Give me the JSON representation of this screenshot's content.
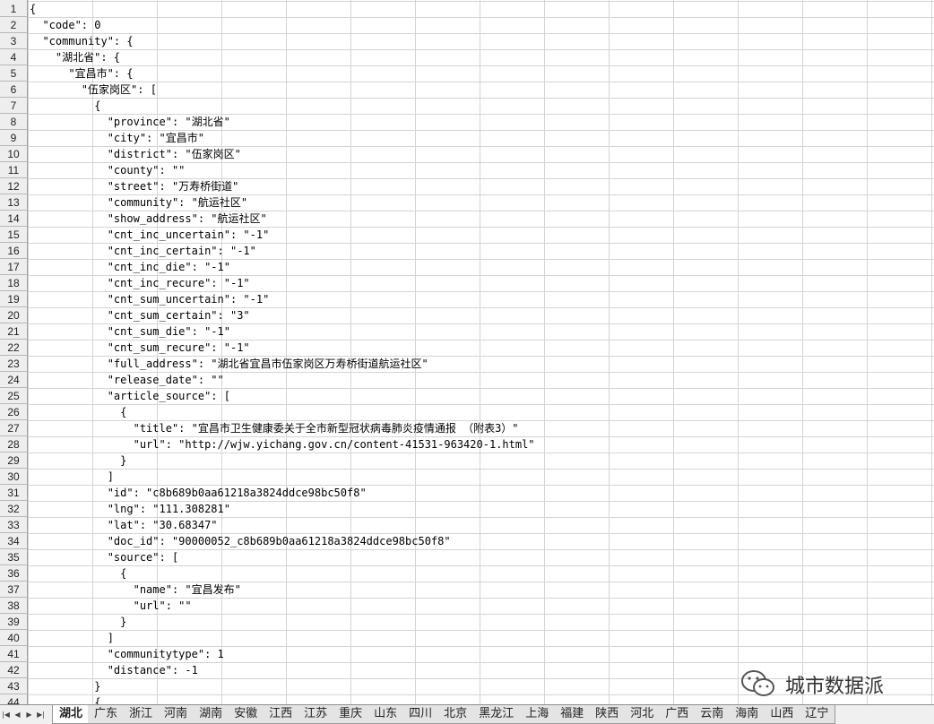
{
  "lines": [
    "{",
    "  \"code\": 0",
    "  \"community\": {",
    "    \"湖北省\": {",
    "      \"宜昌市\": {",
    "        \"伍家岗区\": [",
    "          {",
    "            \"province\": \"湖北省\"",
    "            \"city\": \"宜昌市\"",
    "            \"district\": \"伍家岗区\"",
    "            \"county\": \"\"",
    "            \"street\": \"万寿桥街道\"",
    "            \"community\": \"航运社区\"",
    "            \"show_address\": \"航运社区\"",
    "            \"cnt_inc_uncertain\": \"-1\"",
    "            \"cnt_inc_certain\": \"-1\"",
    "            \"cnt_inc_die\": \"-1\"",
    "            \"cnt_inc_recure\": \"-1\"",
    "            \"cnt_sum_uncertain\": \"-1\"",
    "            \"cnt_sum_certain\": \"3\"",
    "            \"cnt_sum_die\": \"-1\"",
    "            \"cnt_sum_recure\": \"-1\"",
    "            \"full_address\": \"湖北省宜昌市伍家岗区万寿桥街道航运社区\"",
    "            \"release_date\": \"\"",
    "            \"article_source\": [",
    "              {",
    "                \"title\": \"宜昌市卫生健康委关于全市新型冠状病毒肺炎疫情通报 （附表3）\"",
    "                \"url\": \"http://wjw.yichang.gov.cn/content-41531-963420-1.html\"",
    "              }",
    "            ]",
    "            \"id\": \"c8b689b0aa61218a3824ddce98bc50f8\"",
    "            \"lng\": \"111.308281\"",
    "            \"lat\": \"30.68347\"",
    "            \"doc_id\": \"90000052_c8b689b0aa61218a3824ddce98bc50f8\"",
    "            \"source\": [",
    "              {",
    "                \"name\": \"宜昌发布\"",
    "                \"url\": \"\"",
    "              }",
    "            ]",
    "            \"communitytype\": 1",
    "            \"distance\": -1",
    "          }",
    "          {",
    "          {"
  ],
  "sheet_tabs": [
    "湖北",
    "广东",
    "浙江",
    "河南",
    "湖南",
    "安徽",
    "江西",
    "江苏",
    "重庆",
    "山东",
    "四川",
    "北京",
    "黑龙江",
    "上海",
    "福建",
    "陕西",
    "河北",
    "广西",
    "云南",
    "海南",
    "山西",
    "辽宁"
  ],
  "active_tab": "湖北",
  "nav_icons": [
    "first-sheet-icon",
    "prev-sheet-icon",
    "next-sheet-icon",
    "last-sheet-icon"
  ],
  "watermark": {
    "text": "城市数据派",
    "logo": "wechat-logo-icon"
  }
}
